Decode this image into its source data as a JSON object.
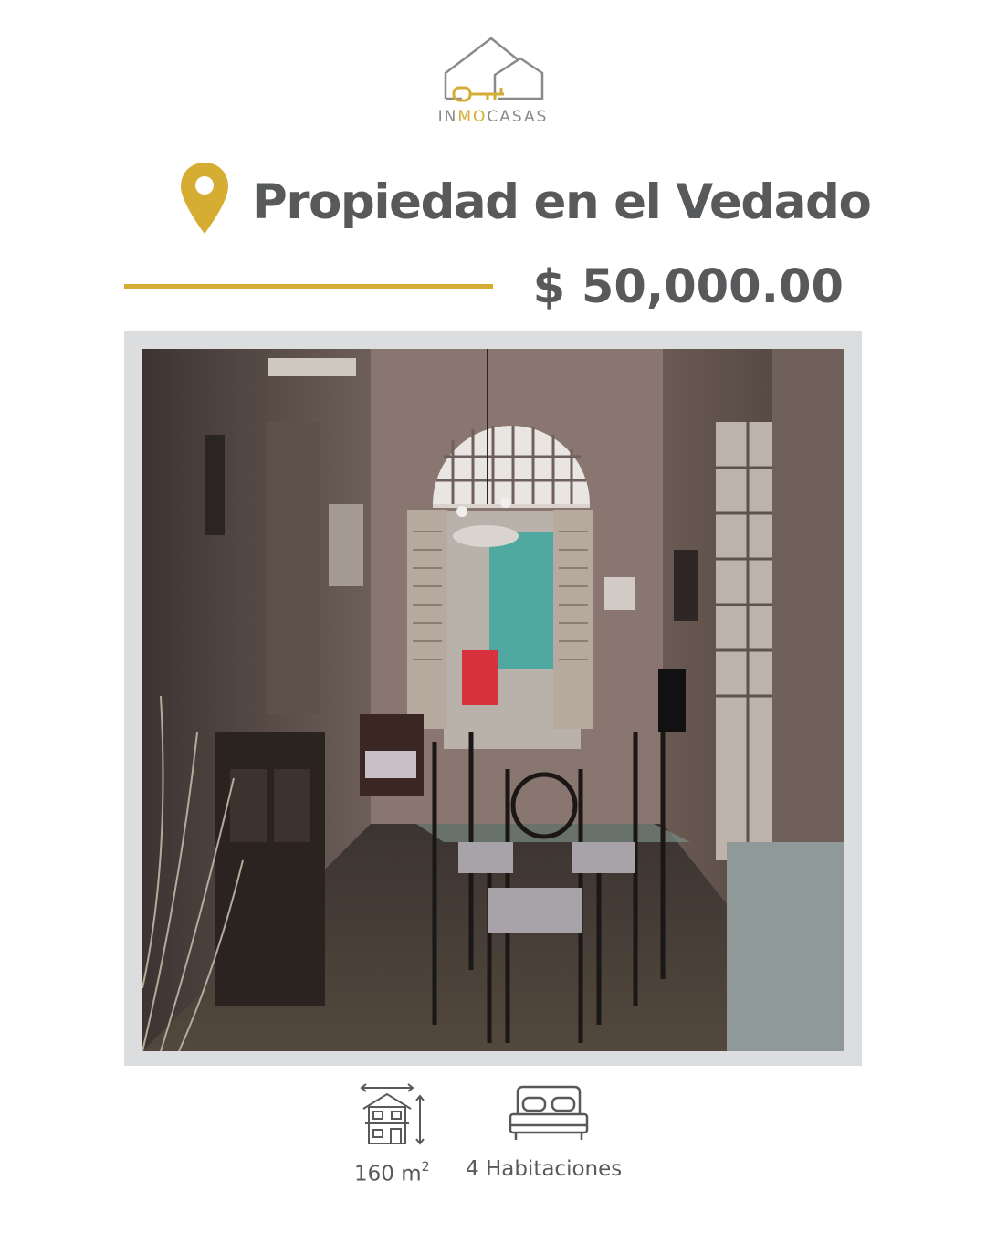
{
  "brand": {
    "name_prefix": "IN",
    "name_highlight": "MO",
    "name_suffix": "CASAS",
    "logo_icon": "house-key-icon"
  },
  "listing": {
    "location_icon": "map-pin-icon",
    "title": "Propiedad en el Vedado",
    "price": "$ 50,000.00"
  },
  "photo": {
    "description_icon": "property-photo"
  },
  "features": {
    "area": {
      "icon": "house-dimensions-icon",
      "value": "160 m",
      "unit_sup": "2"
    },
    "rooms": {
      "icon": "bed-icon",
      "label": "4 Habitaciones"
    }
  },
  "colors": {
    "accent": "#d4ad32",
    "text": "#58595b",
    "frame": "#dcdddf",
    "logo_gray": "#8a8a8a"
  }
}
